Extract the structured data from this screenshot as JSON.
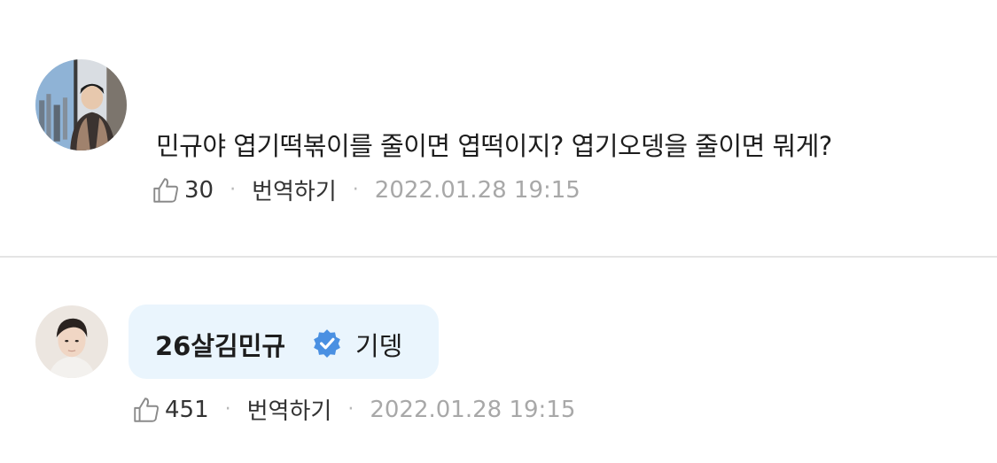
{
  "comment": {
    "text": "민규야 엽기떡볶이를 줄이면 엽떡이지? 엽기오뎅을 줄이면 뭐게?",
    "likes": "30",
    "translate_label": "번역하기",
    "timestamp": "2022.01.28 19:15",
    "separator": "·"
  },
  "reply": {
    "author": "26살김민규",
    "text": "기뎅",
    "likes": "451",
    "translate_label": "번역하기",
    "timestamp": "2022.01.28 19:15",
    "separator": "·"
  },
  "colors": {
    "bubble": "#eaf5fd",
    "verified_badge": "#4a90e2",
    "timestamp": "#a8a8a8",
    "divider": "#e4e4e4"
  }
}
